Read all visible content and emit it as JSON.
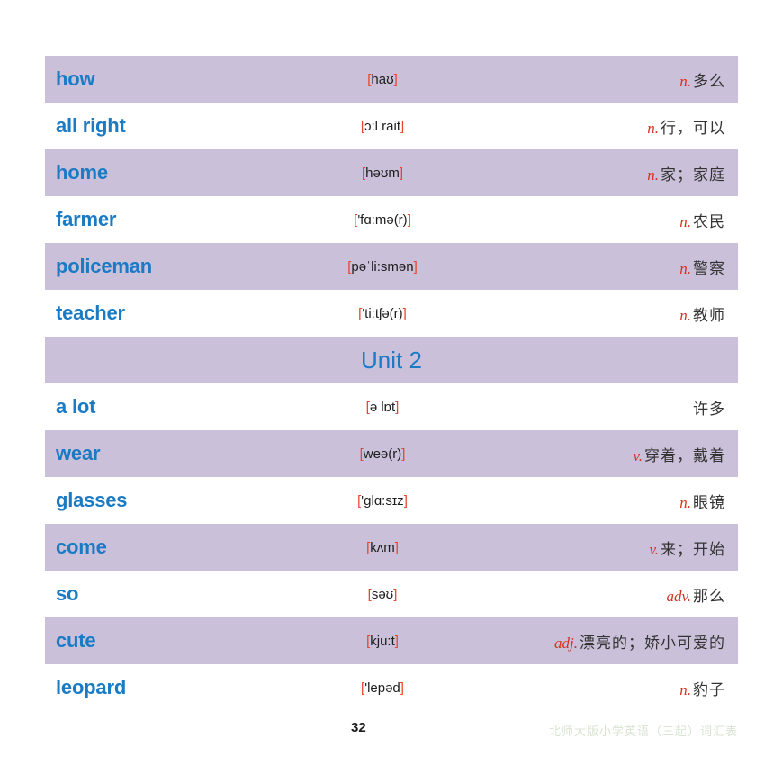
{
  "footer": {
    "page_number": "32",
    "source_note": "北师大版小学英语（三起）词汇表"
  },
  "table": {
    "rows": [
      {
        "kind": "entry",
        "shaded": true,
        "word": "how",
        "phonetic_open": "[",
        "phonetic": "haʊ",
        "phonetic_close": "]",
        "pos": "n.",
        "definition": "多么"
      },
      {
        "kind": "entry",
        "shaded": false,
        "word": "all right",
        "phonetic_open": "[",
        "phonetic": "ɔ:l rait",
        "phonetic_close": "]",
        "pos": "n.",
        "definition": "行，可以"
      },
      {
        "kind": "entry",
        "shaded": true,
        "word": "home",
        "phonetic_open": "[",
        "phonetic": "həʊm",
        "phonetic_close": "]",
        "pos": "n.",
        "definition": "家；家庭"
      },
      {
        "kind": "entry",
        "shaded": false,
        "word": "farmer",
        "phonetic_open": "[",
        "phonetic": "'fɑ:mə(r)",
        "phonetic_close": "]",
        "pos": "n.",
        "definition": "农民"
      },
      {
        "kind": "entry",
        "shaded": true,
        "word": "policeman",
        "phonetic_open": "[",
        "phonetic": "pəˈli:smən",
        "phonetic_close": "]",
        "pos": "n.",
        "definition": "警察"
      },
      {
        "kind": "entry",
        "shaded": false,
        "word": "teacher",
        "phonetic_open": "[",
        "phonetic": "'ti:tʃə(r)",
        "phonetic_close": "]",
        "pos": "n.",
        "definition": "教师"
      },
      {
        "kind": "unit",
        "shaded": true,
        "label": "Unit 2"
      },
      {
        "kind": "entry",
        "shaded": false,
        "word": "a lot",
        "phonetic_open": "[",
        "phonetic": "ə lɒt",
        "phonetic_close": "]",
        "pos": "",
        "definition": "许多"
      },
      {
        "kind": "entry",
        "shaded": true,
        "word": "wear",
        "phonetic_open": "[",
        "phonetic": "weə(r)",
        "phonetic_close": "]",
        "pos": "v.",
        "definition": "穿着，戴着"
      },
      {
        "kind": "entry",
        "shaded": false,
        "word": "glasses",
        "phonetic_open": "[",
        "phonetic": "'glɑ:sɪz",
        "phonetic_close": "]",
        "pos": "n.",
        "definition": "眼镜"
      },
      {
        "kind": "entry",
        "shaded": true,
        "word": "come",
        "phonetic_open": "[",
        "phonetic": "kʌm",
        "phonetic_close": "]",
        "pos": "v.",
        "definition": "来；开始"
      },
      {
        "kind": "entry",
        "shaded": false,
        "word": "so",
        "phonetic_open": "[",
        "phonetic": "səʊ",
        "phonetic_close": "]",
        "pos": "adv.",
        "definition": "那么"
      },
      {
        "kind": "entry",
        "shaded": true,
        "word": "cute",
        "phonetic_open": "[",
        "phonetic": "kju:t",
        "phonetic_close": "]",
        "pos": "adj.",
        "definition": "漂亮的；娇小可爱的"
      },
      {
        "kind": "entry",
        "shaded": false,
        "word": "leopard",
        "phonetic_open": "[",
        "phonetic": "'lepəd",
        "phonetic_close": "]",
        "pos": "n.",
        "definition": "豹子"
      }
    ]
  }
}
